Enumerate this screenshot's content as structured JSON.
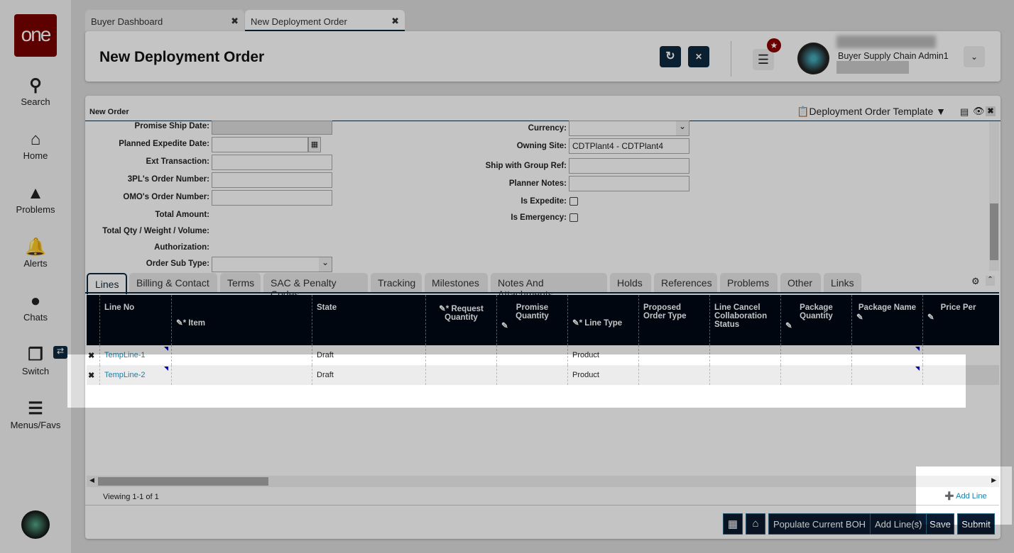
{
  "sidebar": {
    "logo": "one",
    "items": [
      {
        "label": "Search",
        "icon": "search-icon"
      },
      {
        "label": "Home",
        "icon": "home-icon"
      },
      {
        "label": "Problems",
        "icon": "warning-icon"
      },
      {
        "label": "Alerts",
        "icon": "bell-icon"
      },
      {
        "label": "Chats",
        "icon": "chat-icon"
      },
      {
        "label": "Switch",
        "icon": "switch-icon"
      },
      {
        "label": "Menus/Favs",
        "icon": "menu-icon"
      }
    ]
  },
  "tabs": [
    {
      "label": "Buyer Dashboard"
    },
    {
      "label": "New Deployment Order",
      "active": true
    }
  ],
  "header": {
    "title": "New Deployment Order",
    "user": "Buyer Supply Chain Admin1"
  },
  "panel": {
    "title": "New Order",
    "template": "Deployment Order Template"
  },
  "form_left": [
    {
      "label": "Promise Ship Date:",
      "value": ""
    },
    {
      "label": "Planned Expedite Date:",
      "value": ""
    },
    {
      "label": "Ext Transaction:",
      "value": ""
    },
    {
      "label": "3PL's Order Number:",
      "value": ""
    },
    {
      "label": "OMO's Order Number:",
      "value": ""
    },
    {
      "label": "Total Amount:"
    },
    {
      "label": "Total Qty / Weight / Volume:"
    },
    {
      "label": "Authorization:"
    },
    {
      "label": "Order Sub Type:",
      "value": ""
    }
  ],
  "form_right": [
    {
      "label": "Currency:",
      "value": ""
    },
    {
      "label": "Owning Site:",
      "value": "CDTPlant4 - CDTPlant4"
    },
    {
      "label": "Ship with Group Ref:",
      "value": ""
    },
    {
      "label": "Planner Notes:",
      "value": ""
    },
    {
      "label": "Is Expedite:",
      "checked": false
    },
    {
      "label": "Is Emergency:",
      "checked": false
    }
  ],
  "line_tabs": [
    "Lines",
    "Billing & Contact",
    "Terms",
    "SAC & Penalty Codes",
    "Tracking",
    "Milestones",
    "Notes And Attachments",
    "Holds",
    "References",
    "Problems",
    "Other",
    "Links"
  ],
  "columns": [
    "Line No",
    "* Item",
    "State",
    "* Request Quantity",
    "Promise Quantity",
    "* Line Type",
    "Proposed Order Type",
    "Line Cancel Collaboration Status",
    "Package Quantity",
    "Package Name",
    "Price Per"
  ],
  "rows": [
    {
      "line_no": "TempLine-1",
      "state": "Draft",
      "line_type": "Product"
    },
    {
      "line_no": "TempLine-2",
      "state": "Draft",
      "line_type": "Product"
    }
  ],
  "footer": {
    "viewing": "Viewing 1-1 of 1",
    "add_line": "Add Line"
  },
  "buttons": {
    "populate": "Populate Current BOH",
    "add_lines": "Add Line(s)",
    "save": "Save",
    "submit": "Submit"
  }
}
